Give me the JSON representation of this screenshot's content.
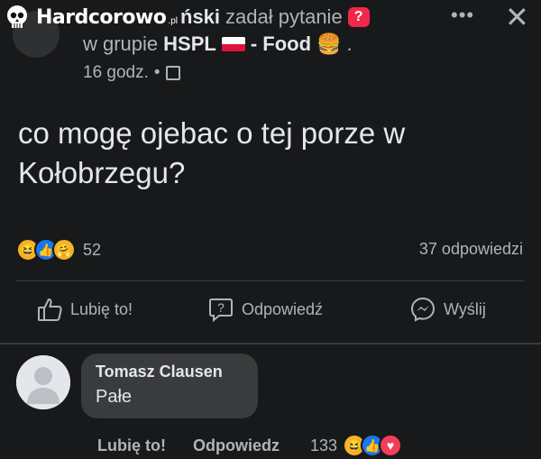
{
  "watermark": {
    "text": "Hardcorowo",
    "suffix": ".pl"
  },
  "header": {
    "author_partial": "ński",
    "action": "zadał pytanie",
    "question_badge": "?",
    "in_group": "w grupie",
    "group_name_prefix": "HSPL",
    "group_name_suffix": "- Food",
    "group_emoji": "🍔",
    "group_trailing": ".",
    "time": "16 godz.",
    "dot": "•"
  },
  "post": {
    "text": "co mogę ojebac o tej porze w Kołobrzegu?"
  },
  "stats": {
    "reaction_count": "52",
    "answers": "37 odpowiedzi"
  },
  "actions": {
    "like": "Lubię to!",
    "answer": "Odpowiedź",
    "send": "Wyślij"
  },
  "comment": {
    "author": "Tomasz Clausen",
    "text": "Pałe",
    "like": "Lubię to!",
    "reply": "Odpowiedz",
    "reaction_count": "133"
  },
  "colors": {
    "background": "#18191a",
    "bubble": "#3a3b3c",
    "like_blue": "#1877f2",
    "haha_yellow": "#f7b125",
    "love_red": "#f33e58"
  }
}
